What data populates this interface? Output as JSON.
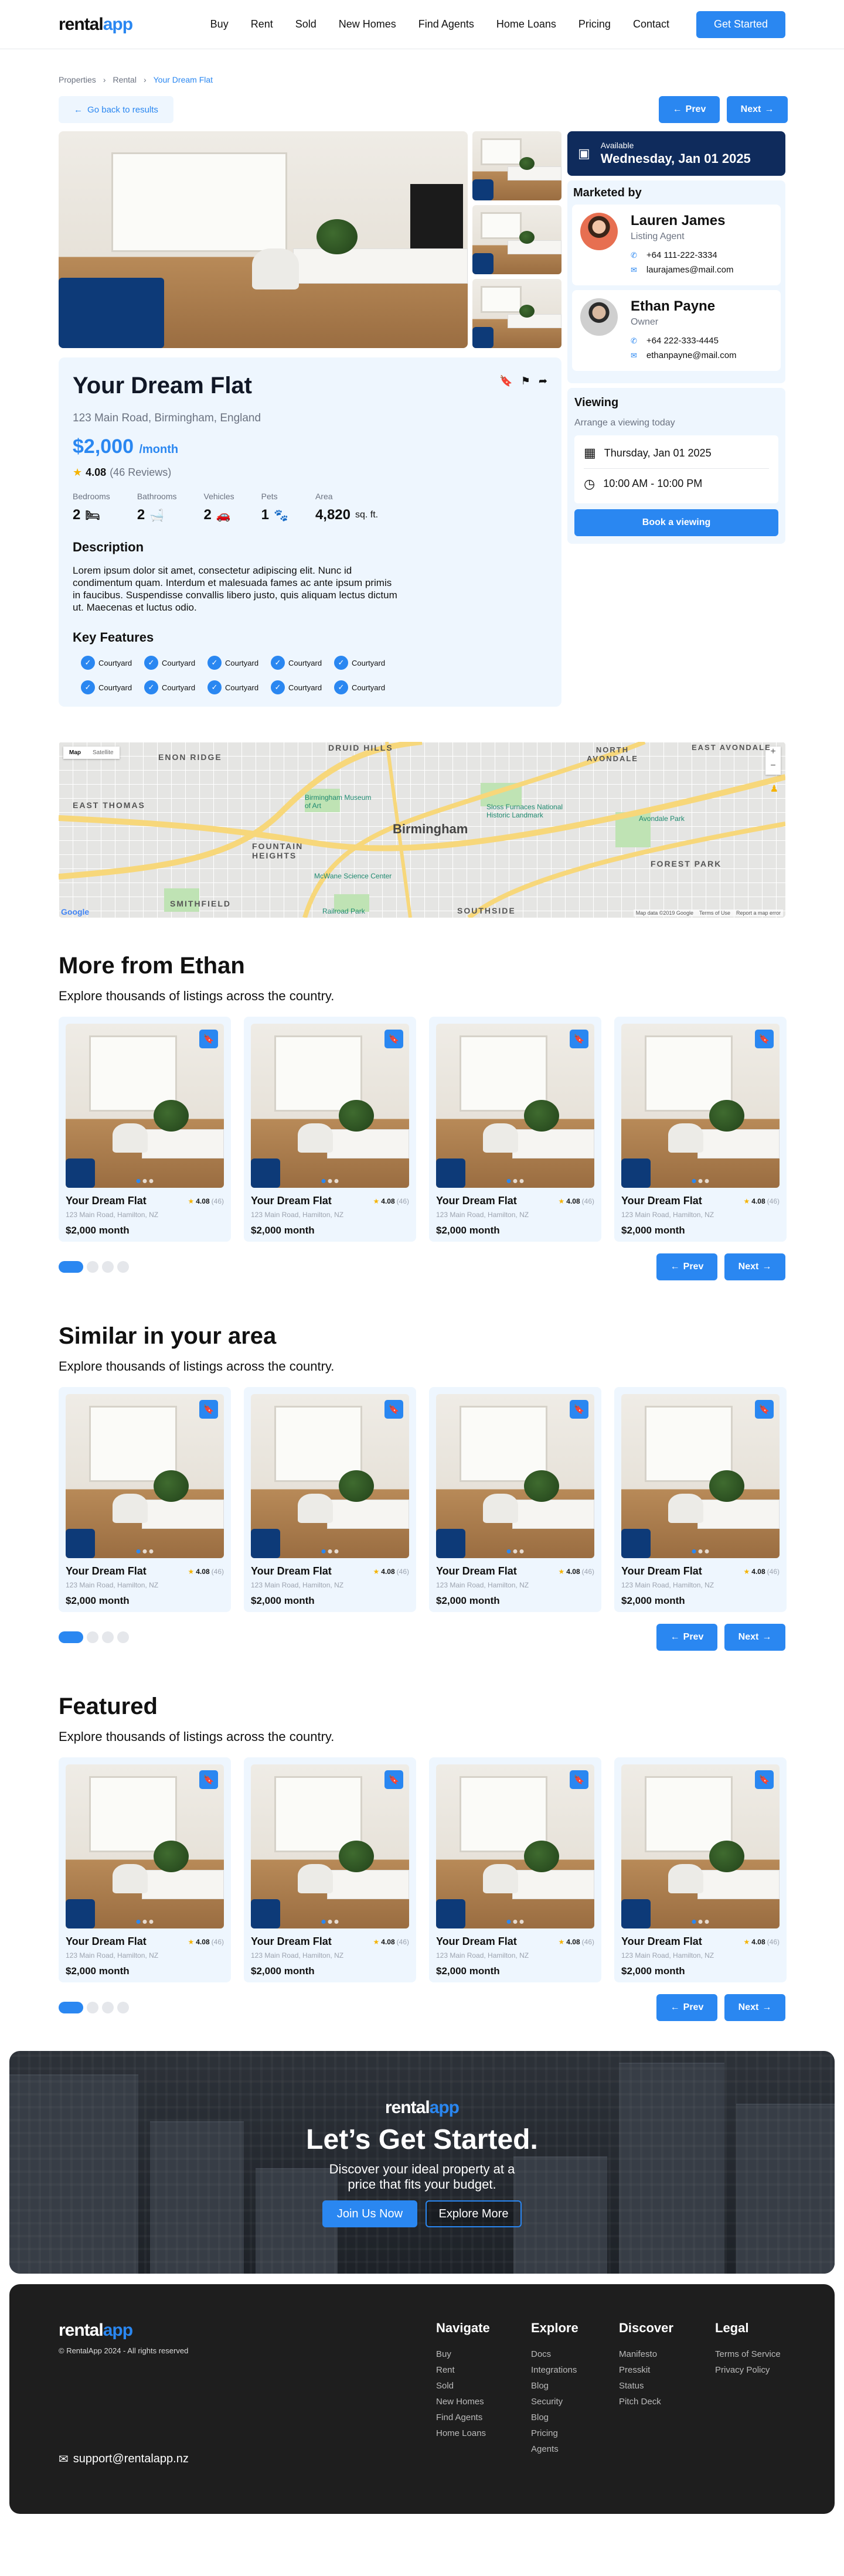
{
  "header": {
    "logo_main": "rental",
    "logo_accent": "app",
    "nav": [
      "Buy",
      "Rent",
      "Sold",
      "New Homes",
      "Find Agents",
      "Home Loans",
      "Pricing",
      "Contact"
    ],
    "cta": "Get Started"
  },
  "breadcrumb": [
    "Properties",
    "Rental",
    "Your Dream Flat"
  ],
  "back_label": "Go back to results",
  "pager": {
    "prev": "Prev",
    "next": "Next"
  },
  "listing": {
    "title": "Your Dream Flat",
    "address": "123 Main Road, Birmingham, England",
    "price": "$2,000",
    "price_unit": "/month",
    "rating": "4.08",
    "reviews": "(46 Reviews)",
    "features": [
      {
        "label": "Bedrooms",
        "value": "2",
        "icon": "bed-icon"
      },
      {
        "label": "Bathrooms",
        "value": "2",
        "icon": "bath-icon"
      },
      {
        "label": "Vehicles",
        "value": "2",
        "icon": "car-icon"
      },
      {
        "label": "Pets",
        "value": "1",
        "icon": "pet-icon"
      },
      {
        "label": "Area",
        "value": "4,820",
        "unit": "sq. ft."
      }
    ],
    "description_heading": "Description",
    "description": "Lorem ipsum dolor sit amet, consectetur adipiscing elit. Nunc id condimentum quam. Interdum et malesuada fames ac ante ipsum primis in faucibus. Suspendisse convallis libero justo, quis aliquam lectus dictum ut. Maecenas et luctus odio.",
    "key_features_heading": "Key Features",
    "key_features": [
      "Courtyard",
      "Courtyard",
      "Courtyard",
      "Courtyard",
      "Courtyard",
      "Courtyard",
      "Courtyard",
      "Courtyard",
      "Courtyard",
      "Courtyard"
    ]
  },
  "availability": {
    "label": "Available",
    "date": "Wednesday, Jan 01 2025"
  },
  "marketed": {
    "heading": "Marketed by",
    "agents": [
      {
        "name": "Lauren James",
        "role": "Listing Agent",
        "phone": "+64 111-222-3334",
        "email": "laurajames@mail.com"
      },
      {
        "name": "Ethan Payne",
        "role": "Owner",
        "phone": "+64 222-333-4445",
        "email": "ethanpayne@mail.com"
      }
    ]
  },
  "viewing": {
    "heading": "Viewing",
    "subtitle": "Arrange a viewing today",
    "date": "Thursday, Jan 01 2025",
    "time": "10:00 AM - 10:00 PM",
    "button": "Book a viewing"
  },
  "map": {
    "type_map": "Map",
    "type_satellite": "Satellite",
    "city": "Birmingham",
    "labels": [
      "ENON RIDGE",
      "DRUID HILLS",
      "NORTH AVONDALE",
      "EAST AVONDALE",
      "EAST THOMAS",
      "FOUNTAIN HEIGHTS",
      "SMITHFIELD",
      "SOUTHSIDE",
      "FOREST PARK",
      "Birmingham Museum of Art",
      "Sloss Furnaces National Historic Landmark",
      "Avondale Park",
      "McWane Science Center",
      "Railroad Park"
    ],
    "attribution": "Map data ©2019 Google",
    "terms": "Terms of Use",
    "report": "Report a map error"
  },
  "card": {
    "title": "Your Dream Flat",
    "rating": "4.08",
    "reviews": "(46)",
    "address": "123 Main Road, Hamilton, NZ",
    "price": "$2,000 month"
  },
  "sections": [
    {
      "title": "More from Ethan",
      "subtitle": "Explore thousands of listings across the country."
    },
    {
      "title": "Similar in your area",
      "subtitle": "Explore thousands of listings across the country."
    },
    {
      "title": "Featured",
      "subtitle": "Explore thousands of listings across the country."
    }
  ],
  "cta": {
    "logo_main": "rental",
    "logo_accent": "app",
    "title": "Let’s Get Started.",
    "text": "Discover your ideal property at a price that fits your budget.",
    "primary": "Join Us Now",
    "secondary": "Explore More"
  },
  "footer": {
    "logo_main": "rental",
    "logo_accent": "app",
    "copyright": "© RentalApp 2024 - All rights reserved",
    "email": "support@rentalapp.nz",
    "columns": [
      {
        "heading": "Navigate",
        "links": [
          "Buy",
          "Rent",
          "Sold",
          "New Homes",
          "Find Agents",
          "Home Loans"
        ]
      },
      {
        "heading": "Explore",
        "links": [
          "Docs",
          "Integrations",
          "Blog",
          "Security",
          "Blog",
          "Pricing",
          "Agents"
        ]
      },
      {
        "heading": "Discover",
        "links": [
          "Manifesto",
          "Presskit",
          "Status",
          "Pitch Deck"
        ]
      },
      {
        "heading": "Legal",
        "links": [
          "Terms of Service",
          "Privacy Policy"
        ]
      }
    ]
  },
  "colors": {
    "accent": "#2a87f1",
    "navy": "#0f2b5c",
    "panel": "#eef6fe",
    "footer": "#1e1e1e"
  }
}
